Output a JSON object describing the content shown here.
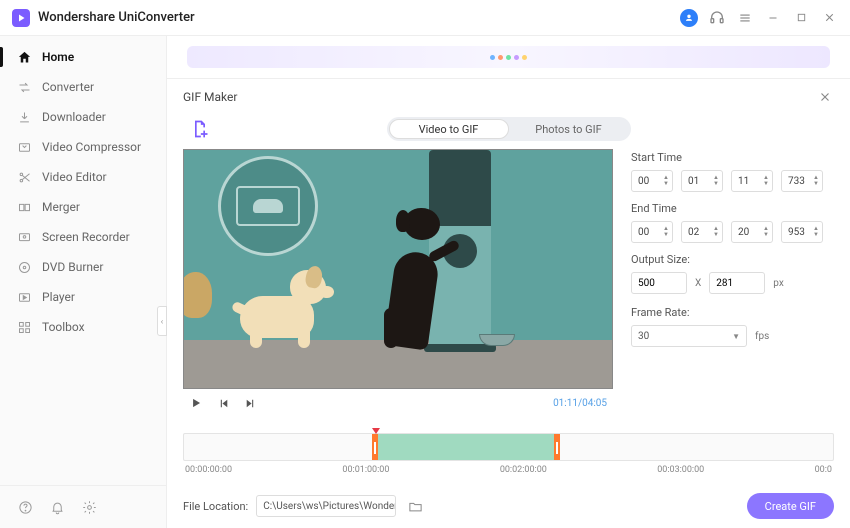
{
  "app": {
    "title": "Wondershare UniConverter"
  },
  "sidebar": {
    "items": [
      {
        "label": "Home"
      },
      {
        "label": "Converter"
      },
      {
        "label": "Downloader"
      },
      {
        "label": "Video Compressor"
      },
      {
        "label": "Video Editor"
      },
      {
        "label": "Merger"
      },
      {
        "label": "Screen Recorder"
      },
      {
        "label": "DVD Burner"
      },
      {
        "label": "Player"
      },
      {
        "label": "Toolbox"
      }
    ]
  },
  "gif": {
    "title": "GIF Maker",
    "tabs": {
      "video": "Video to GIF",
      "photos": "Photos to GIF"
    },
    "playback": {
      "time": "01:11/04:05"
    },
    "settings": {
      "start_label": "Start Time",
      "end_label": "End Time",
      "start": {
        "h": "00",
        "m": "01",
        "s": "11",
        "ms": "733"
      },
      "end": {
        "h": "00",
        "m": "02",
        "s": "20",
        "ms": "953"
      },
      "output_label": "Output Size:",
      "width": "500",
      "height": "281",
      "x": "X",
      "px": "px",
      "frame_label": "Frame Rate:",
      "frame_rate": "30",
      "fps": "fps"
    },
    "timeline": {
      "ticks": [
        "00:00:00:00",
        "00:01:00:00",
        "00:02:00:00",
        "00:03:00:00",
        "00:0"
      ]
    },
    "footer": {
      "loc_label": "File Location:",
      "path": "C:\\Users\\ws\\Pictures\\Wonders",
      "create": "Create GIF"
    }
  }
}
